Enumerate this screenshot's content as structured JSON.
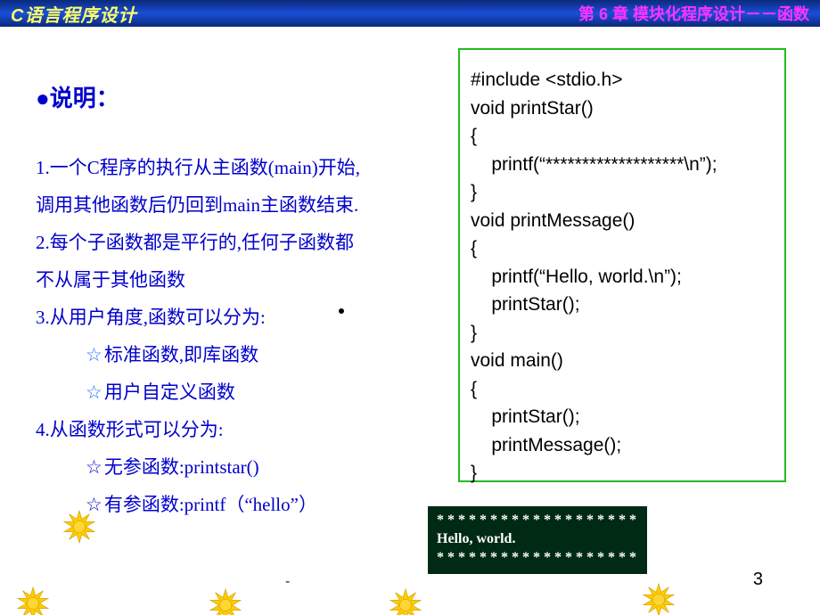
{
  "header": {
    "left": "C语言程序设计",
    "right": "第 6 章  模块化程序设计－－函数"
  },
  "left": {
    "heading": "●说明：",
    "p1_l1": "1.一个C程序的执行从主函数(main)开始,",
    "p1_l2": "调用其他函数后仍回到main主函数结束.",
    "p2_l1": "2.每个子函数都是平行的,任何子函数都",
    "p2_l2": "不从属于其他函数",
    "p3": "3.从用户角度,函数可以分为:",
    "p3_b1": "标准函数,即库函数",
    "p3_b2": "用户自定义函数",
    "p4": "4.从函数形式可以分为:",
    "p4_b1": "无参函数:printstar()",
    "p4_b2": "有参函数:printf（“hello”）"
  },
  "code": "#include <stdio.h>\nvoid printStar()\n{\n    printf(“*******************\\n”);\n}\nvoid printMessage()\n{\n    printf(“Hello, world.\\n”);\n    printStar();\n}\nvoid main()\n{\n    printStar();\n    printMessage();\n}",
  "output": {
    "l1": "* * * * * * * * * * * * * * * * * * *",
    "l2": "Hello, world.",
    "l3": "* * * * * * * * * * * * * * * * * * *"
  },
  "page_num": "3",
  "dash": "-"
}
